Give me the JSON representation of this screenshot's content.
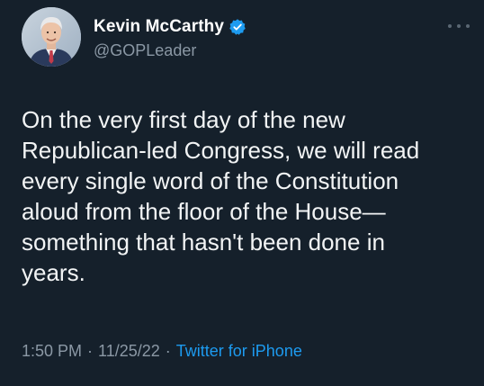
{
  "tweet": {
    "author": {
      "display_name": "Kevin McCarthy",
      "handle": "@GOPLeader",
      "verified": true,
      "avatar_icon": "profile-photo"
    },
    "more_icon": "more-horizontal-icon",
    "text": "On the very first day of the new\nRepublican-led Congress, we will read\nevery single word of the Constitution\naloud from the floor of the House—\nsomething that hasn't been done in\nyears.",
    "time": "1:50 PM",
    "date": "11/25/22",
    "separator": "·",
    "source": "Twitter for iPhone"
  },
  "colors": {
    "background": "#15202b",
    "text": "#f2f4f5",
    "secondary": "#8b98a5",
    "accent": "#1d9bf0"
  }
}
